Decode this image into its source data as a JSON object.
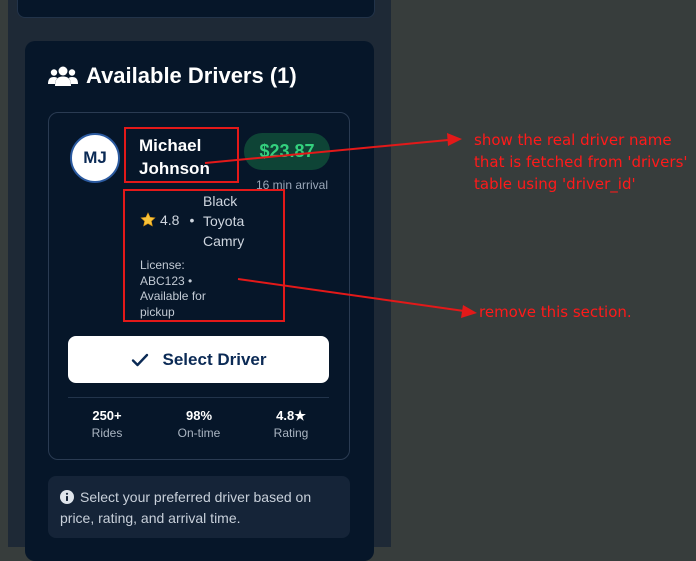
{
  "section": {
    "title": "Available Drivers (1)",
    "icon": "users-icon"
  },
  "driver": {
    "initials": "MJ",
    "name": "Michael Johnson",
    "price": "$23.87",
    "arrival": "16 min arrival",
    "rating": "4.8",
    "separator": "•",
    "vehicle": "Black Toyota Camry",
    "license_info": "License: ABC123 • Available for pickup"
  },
  "actions": {
    "select_label": "Select Driver"
  },
  "stats": [
    {
      "value": "250+",
      "label": "Rides"
    },
    {
      "value": "98%",
      "label": "On-time"
    },
    {
      "value": "4.8★",
      "label": "Rating"
    }
  ],
  "info": {
    "text": "Select your preferred driver based on price, rating, and arrival time."
  },
  "annotations": {
    "name_note": "show the real driver name that is fetched from 'drivers' table using 'driver_id'",
    "remove_note": "remove this section."
  },
  "colors": {
    "background": "#373d3c",
    "panel": "#061629",
    "price_green": "#34d17e",
    "annotation_red": "#e31919"
  }
}
